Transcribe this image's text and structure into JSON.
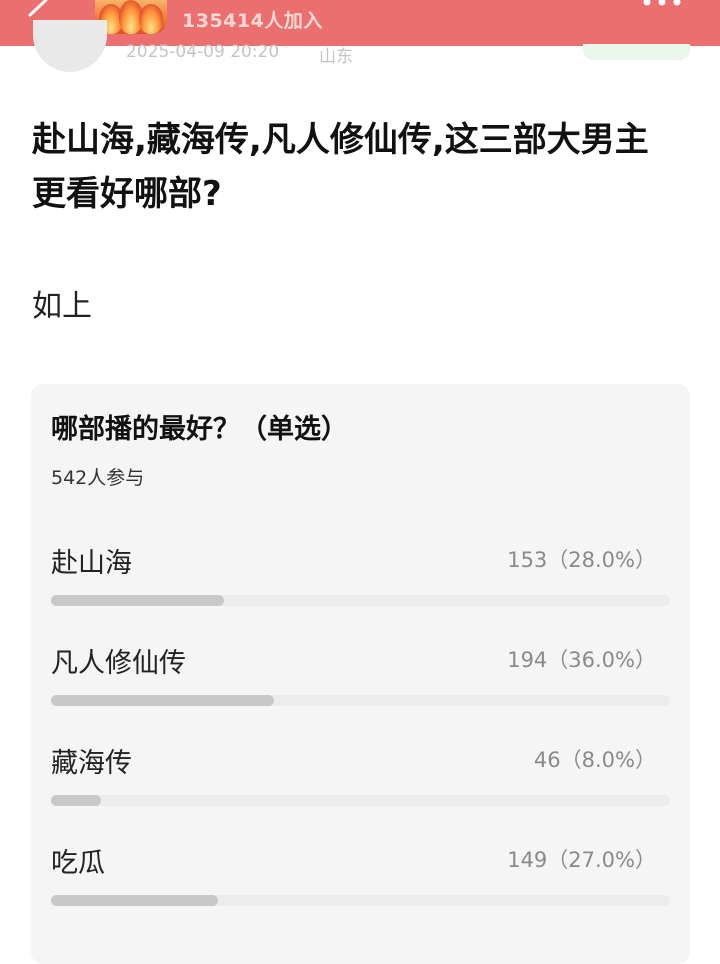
{
  "header": {
    "member_count": "135414人加入"
  },
  "post": {
    "time": "2025-04-09 20:20",
    "region": "山东",
    "title": "赴山海,藏海传,凡人修仙传,这三部大男主更看好哪部?",
    "body": "如上"
  },
  "poll": {
    "question": "哪部播的最好？（单选）",
    "participants": "542人参与",
    "options": [
      {
        "label": "赴山海",
        "stat": "153（28.0%）",
        "fraction": 0.28
      },
      {
        "label": "凡人修仙传",
        "stat": "194（36.0%）",
        "fraction": 0.36
      },
      {
        "label": "藏海传",
        "stat": "46（8.0%）",
        "fraction": 0.08
      },
      {
        "label": "吃瓜",
        "stat": "149（27.0%）",
        "fraction": 0.27
      }
    ]
  },
  "colors": {
    "header_bg": "#ec6f70",
    "bar_fill": "#c8c8c8",
    "bar_track": "#ececec",
    "card_bg": "#f5f5f5"
  },
  "icons": {
    "back": "back-arrow-icon",
    "more": "more-dots-icon"
  }
}
